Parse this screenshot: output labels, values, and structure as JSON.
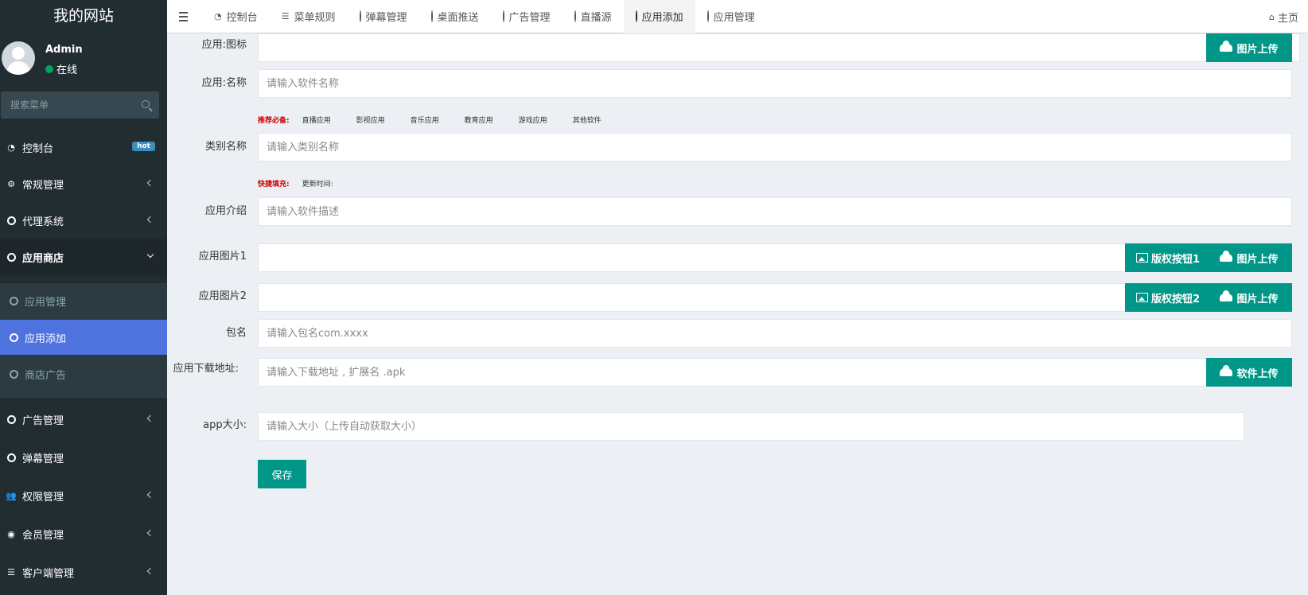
{
  "app": {
    "title": "我的网站"
  },
  "user": {
    "name": "Admin",
    "status": "在线"
  },
  "search": {
    "placeholder": "搜索菜单"
  },
  "sidebar": {
    "items": [
      {
        "label": "控制台",
        "icon": "dashboard-icon",
        "badge": "hot"
      },
      {
        "label": "常规管理",
        "icon": "cogs-icon"
      },
      {
        "label": "代理系统",
        "icon": "circle-icon"
      },
      {
        "label": "应用商店",
        "icon": "circle-icon"
      },
      {
        "label": "广告管理",
        "icon": "circle-icon"
      },
      {
        "label": "弹幕管理",
        "icon": "circle-icon"
      },
      {
        "label": "权限管理",
        "icon": "users-icon"
      },
      {
        "label": "会员管理",
        "icon": "user-circle-icon"
      },
      {
        "label": "客户端管理",
        "icon": "list-icon"
      }
    ],
    "sub_items": [
      {
        "label": "应用管理"
      },
      {
        "label": "应用添加"
      },
      {
        "label": "商店广告"
      }
    ]
  },
  "topbar": {
    "tabs": [
      {
        "label": "控制台",
        "icon": "dashboard-icon"
      },
      {
        "label": "菜单规则",
        "icon": "bars-icon"
      },
      {
        "label": "弹幕管理",
        "icon": "circle-icon"
      },
      {
        "label": "桌面推送",
        "icon": "circle-icon"
      },
      {
        "label": "广告管理",
        "icon": "circle-icon"
      },
      {
        "label": "直播源",
        "icon": "circle-icon"
      },
      {
        "label": "应用添加",
        "icon": "circle-icon"
      },
      {
        "label": "应用管理",
        "icon": "circle-icon"
      }
    ],
    "home": "主页"
  },
  "form": {
    "icon_label": "应用:图标",
    "name_label": "应用:名称",
    "name_placeholder": "请输入软件名称",
    "recommend_label": "推荐必备:",
    "recommend_chips": [
      "直播应用",
      "影视应用",
      "音乐应用",
      "教育应用",
      "游戏应用",
      "其他软件"
    ],
    "category_label": "类别名称",
    "category_placeholder": "请输入类别名称",
    "quickfill_label": "快捷填充:",
    "quickfill_chip": "更新时间:",
    "intro_label": "应用介绍",
    "intro_placeholder": "请输入软件描述",
    "pic1_label": "应用图片1",
    "pic2_label": "应用图片2",
    "pkg_label": "包名",
    "pkg_placeholder": "请输入包名com.xxxx",
    "download_label": "应用下载地址:",
    "download_placeholder": "请输入下载地址 , 扩展名 .apk",
    "size_label": "app大小:",
    "size_placeholder": "请输入大小（上传自动获取大小）",
    "upload_image": "图片上传",
    "copyright_btn1": "版权按钮1",
    "copyright_btn2": "版权按钮2",
    "upload_software": "软件上传",
    "save": "保存"
  },
  "colors": {
    "sidebar_bg": "#222d32",
    "active_sub": "#4e73df",
    "green": "#009688",
    "hot_badge": "#3c8dbc"
  }
}
